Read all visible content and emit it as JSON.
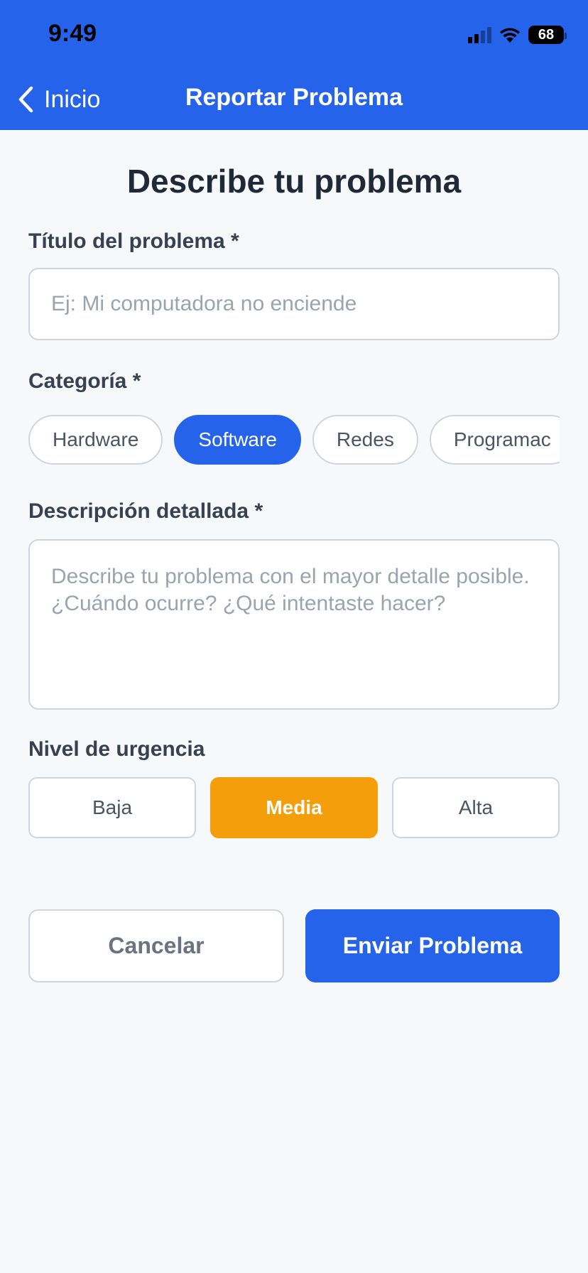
{
  "status_bar": {
    "time": "9:49",
    "battery": "68",
    "icons": [
      "cellular-signal-icon",
      "wifi-icon",
      "battery-icon"
    ]
  },
  "nav": {
    "back_label": "Inicio",
    "title": "Reportar Problema"
  },
  "form": {
    "heading": "Describe tu problema",
    "title_field": {
      "label": "Título del problema *",
      "placeholder": "Ej: Mi computadora no enciende",
      "value": ""
    },
    "category": {
      "label": "Categoría *",
      "options": [
        "Hardware",
        "Software",
        "Redes",
        "Programac"
      ],
      "selected": "Software"
    },
    "description": {
      "label": "Descripción detallada *",
      "placeholder": "Describe tu problema con el mayor detalle posible. ¿Cuándo ocurre? ¿Qué intentaste hacer?",
      "value": ""
    },
    "urgency": {
      "label": "Nivel de urgencia",
      "options": [
        "Baja",
        "Media",
        "Alta"
      ],
      "selected": "Media"
    },
    "actions": {
      "cancel_label": "Cancelar",
      "submit_label": "Enviar Problema"
    }
  },
  "colors": {
    "primary": "#2563EB",
    "urgency_active": "#F59E0B",
    "background": "#F7F8FA",
    "border": "#D1D5DB"
  }
}
